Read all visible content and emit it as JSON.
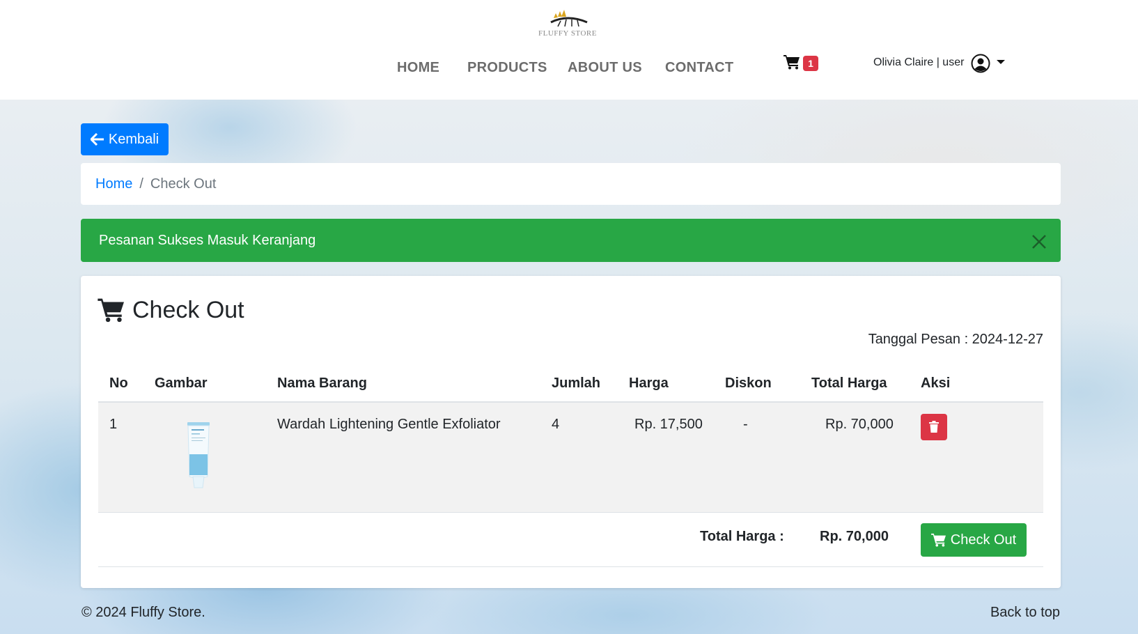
{
  "brand": {
    "logo_text": "FLUFFY STORE"
  },
  "nav": {
    "items": [
      {
        "label": "HOME"
      },
      {
        "label": "PRODUCTS"
      },
      {
        "label": "ABOUT US"
      },
      {
        "label": "CONTACT"
      }
    ]
  },
  "cart": {
    "count": "1"
  },
  "user": {
    "label": "Olivia Claire | user"
  },
  "back_button": {
    "label": "Kembali"
  },
  "breadcrumb": {
    "home": "Home",
    "separator": "/",
    "current": "Check Out"
  },
  "alert": {
    "message": "Pesanan Sukses Masuk Keranjang"
  },
  "checkout": {
    "title": "Check Out",
    "order_date": "Tanggal Pesan : 2024-12-27",
    "columns": [
      "No",
      "Gambar",
      "Nama Barang",
      "Jumlah",
      "Harga",
      "Diskon",
      "Total Harga",
      "Aksi"
    ],
    "rows": [
      {
        "no": "1",
        "name": "Wardah Lightening Gentle Exfoliator",
        "qty": "4",
        "price": "Rp. 17,500",
        "discount": "-",
        "total": "Rp. 70,000"
      }
    ],
    "total_label": "Total Harga :",
    "total_value": "Rp. 70,000",
    "checkout_button": "Check Out"
  },
  "footer": {
    "copyright": "© 2024 Fluffy Store.",
    "back_to_top": "Back to top"
  },
  "colors": {
    "primary": "#007bff",
    "success": "#28a745",
    "danger": "#dc3545"
  }
}
